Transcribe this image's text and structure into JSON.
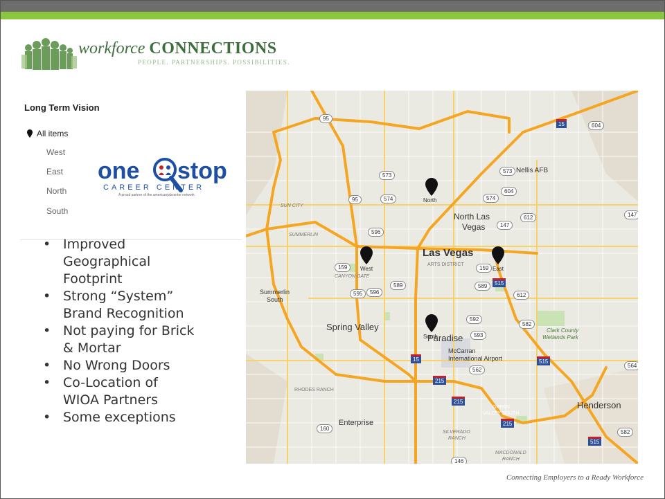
{
  "brand": {
    "name_italic": "workforce",
    "name_bold": "CONNECTIONS",
    "tagline": "PEOPLE. PARTNERSHIPS. POSSIBILITIES."
  },
  "panel": {
    "title": "Long Term Vision",
    "all_items": "All items",
    "regions": [
      "West",
      "East",
      "North",
      "South"
    ]
  },
  "onestop": {
    "word_one": "one",
    "word_stop": "stop",
    "career_center": "CAREER CENTER",
    "partner_line": "A proud partner of the americanjobcenter network"
  },
  "bullets": [
    "Improved Geographical Footprint",
    "Strong “System” Brand Recognition",
    "Not paying for Brick & Mortar",
    "No Wrong Doors",
    "Co-Location of WIOA Partners",
    "Some exceptions"
  ],
  "map": {
    "pins": [
      "North",
      "West",
      "East",
      "South"
    ],
    "labels": {
      "las_vegas": "Las Vegas",
      "north_las_vegas_1": "North Las",
      "north_las_vegas_2": "Vegas",
      "nellis": "Nellis AFB",
      "arts_district": "ARTS DISTRICT",
      "sun_city": "SUN CITY",
      "summerlin": "SUMMERLIN",
      "canyon_gate": "CANYON GATE",
      "summerlin_south_1": "Summerlin",
      "summerlin_south_2": "South",
      "spring_valley": "Spring Valley",
      "paradise": "Paradise",
      "mccarran_1": "McCarran",
      "mccarran_2": "International Airport",
      "clark_county_1": "Clark County",
      "clark_county_2": "Wetlands Park",
      "rhodes_ranch": "RHODES RANCH",
      "enterprise": "Enterprise",
      "green_valley_1": "GREEN",
      "green_valley_2": "VALLEY SOUTH",
      "henderson": "Henderson",
      "silverado_1": "SILVERADO",
      "silverado_2": "RANCH",
      "macdonald_1": "MACDONALD",
      "macdonald_2": "RANCH"
    },
    "shields": [
      "95",
      "604",
      "573",
      "573",
      "604",
      "574",
      "574",
      "612",
      "147",
      "147",
      "596",
      "159",
      "159",
      "589",
      "589",
      "595",
      "596",
      "612",
      "592",
      "593",
      "582",
      "562",
      "564",
      "160",
      "582",
      "146",
      "95"
    ],
    "interstates": [
      "15",
      "515",
      "15",
      "515",
      "215",
      "215",
      "215",
      "515"
    ]
  },
  "footer": "Connecting Employers to a Ready Workforce",
  "colors": {
    "green": "#8cc63f",
    "dark_bar": "#6d6d6d",
    "highway": "#f4a623",
    "onestop_blue": "#1d4fa3",
    "onestop_red": "#c8202a"
  }
}
